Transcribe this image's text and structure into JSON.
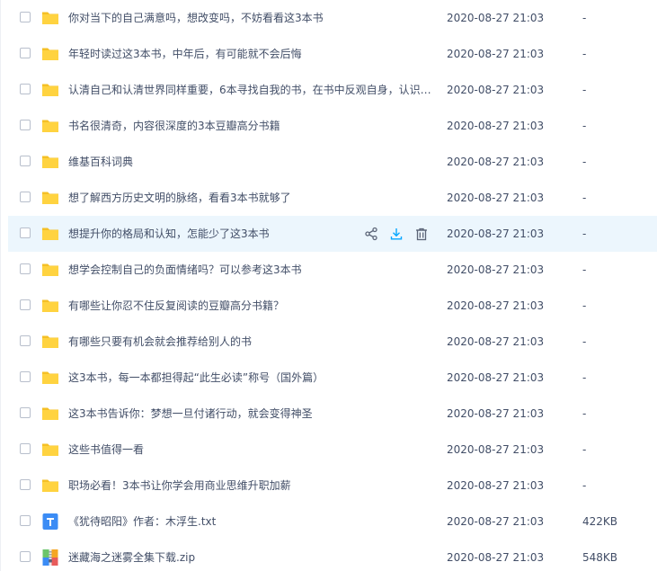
{
  "files": [
    {
      "name": "你对当下的自己满意吗，想改变吗，不妨看看这3本书",
      "date": "2020-08-27 21:03",
      "size": "-",
      "type": "folder"
    },
    {
      "name": "年轻时读过这3本书，中年后，有可能就不会后悔",
      "date": "2020-08-27 21:03",
      "size": "-",
      "type": "folder"
    },
    {
      "name": "认清自己和认清世界同样重要，6本寻找自我的书，在书中反观自身，认识…",
      "date": "2020-08-27 21:03",
      "size": "-",
      "type": "folder"
    },
    {
      "name": "书名很清奇，内容很深度的3本豆瓣高分书籍",
      "date": "2020-08-27 21:03",
      "size": "-",
      "type": "folder"
    },
    {
      "name": "维基百科词典",
      "date": "2020-08-27 21:03",
      "size": "-",
      "type": "folder"
    },
    {
      "name": "想了解西方历史文明的脉络，看看3本书就够了",
      "date": "2020-08-27 21:03",
      "size": "-",
      "type": "folder"
    },
    {
      "name": "想提升你的格局和认知，怎能少了这3本书",
      "date": "2020-08-27 21:03",
      "size": "-",
      "type": "folder",
      "hover": true
    },
    {
      "name": "想学会控制自己的负面情绪吗？可以参考这3本书",
      "date": "2020-08-27 21:03",
      "size": "-",
      "type": "folder"
    },
    {
      "name": "有哪些让你忍不住反复阅读的豆瓣高分书籍？",
      "date": "2020-08-27 21:03",
      "size": "-",
      "type": "folder"
    },
    {
      "name": "有哪些只要有机会就会推荐给别人的书",
      "date": "2020-08-27 21:03",
      "size": "-",
      "type": "folder"
    },
    {
      "name": "这3本书，每一本都担得起“此生必读”称号（国外篇）",
      "date": "2020-08-27 21:03",
      "size": "-",
      "type": "folder"
    },
    {
      "name": "这3本书告诉你：梦想一旦付诸行动，就会变得神圣",
      "date": "2020-08-27 21:03",
      "size": "-",
      "type": "folder"
    },
    {
      "name": "这些书值得一看",
      "date": "2020-08-27 21:03",
      "size": "-",
      "type": "folder"
    },
    {
      "name": "职场必看！3本书让你学会用商业思维升职加薪",
      "date": "2020-08-27 21:03",
      "size": "-",
      "type": "folder"
    },
    {
      "name": "《犹待昭阳》作者：木浮生.txt",
      "date": "2020-08-27 21:03",
      "size": "422KB",
      "type": "txt"
    },
    {
      "name": "迷藏海之迷雾全集下载.zip",
      "date": "2020-08-27 21:03",
      "size": "548KB",
      "type": "zip"
    }
  ],
  "hover_actions": {
    "share_icon": "share-icon",
    "download_icon": "download-icon",
    "delete_icon": "trash-icon"
  },
  "colors": {
    "folder": "#ffd340",
    "folder_tab": "#f5c026",
    "txt": "#3b8cf5",
    "zip_a": "#6cc56b",
    "zip_b": "#f5a623",
    "zip_c": "#3b8cf5",
    "zip_d": "#e85b5b",
    "action": "#5c6578",
    "action_active": "#06a7ff",
    "hover_bg": "#ecf6fd"
  }
}
